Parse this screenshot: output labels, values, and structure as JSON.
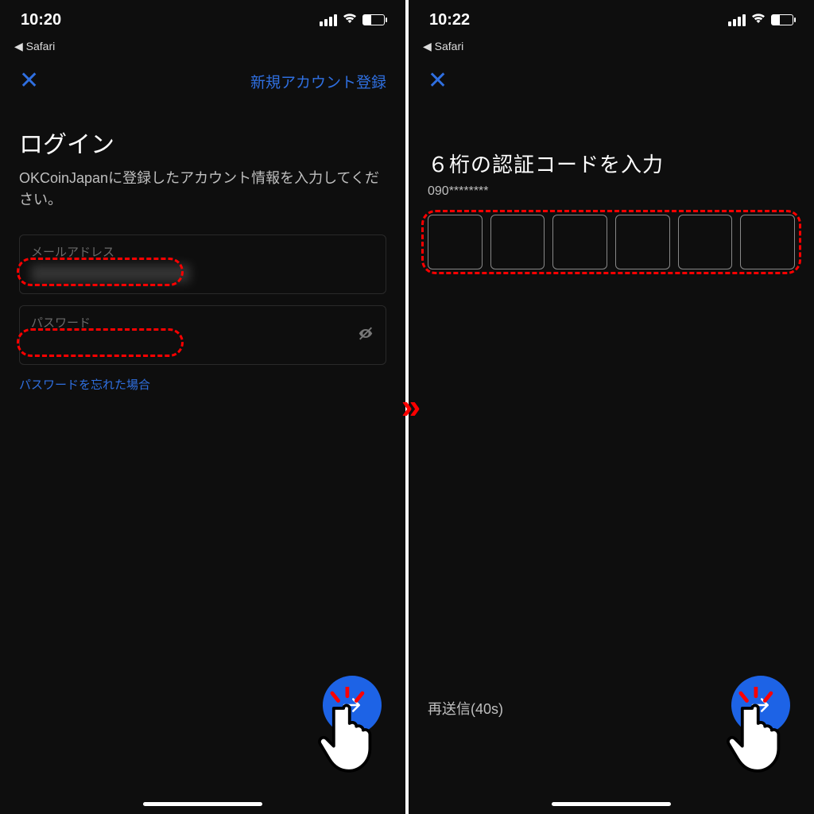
{
  "left": {
    "status_time": "10:20",
    "back_app": "◀ Safari",
    "signup_link": "新規アカウント登録",
    "title": "ログイン",
    "subtitle": "OKCoinJapanに登録したアカウント情報を入力してください。",
    "email_label": "メールアドレス",
    "password_label": "パスワード",
    "forgot": "パスワードを忘れた場合"
  },
  "right": {
    "status_time": "10:22",
    "back_app": "◀ Safari",
    "title": "６桁の認証コードを入力",
    "phone_masked": "090********",
    "resend": "再送信(40s)"
  },
  "mid_arrow": "»"
}
